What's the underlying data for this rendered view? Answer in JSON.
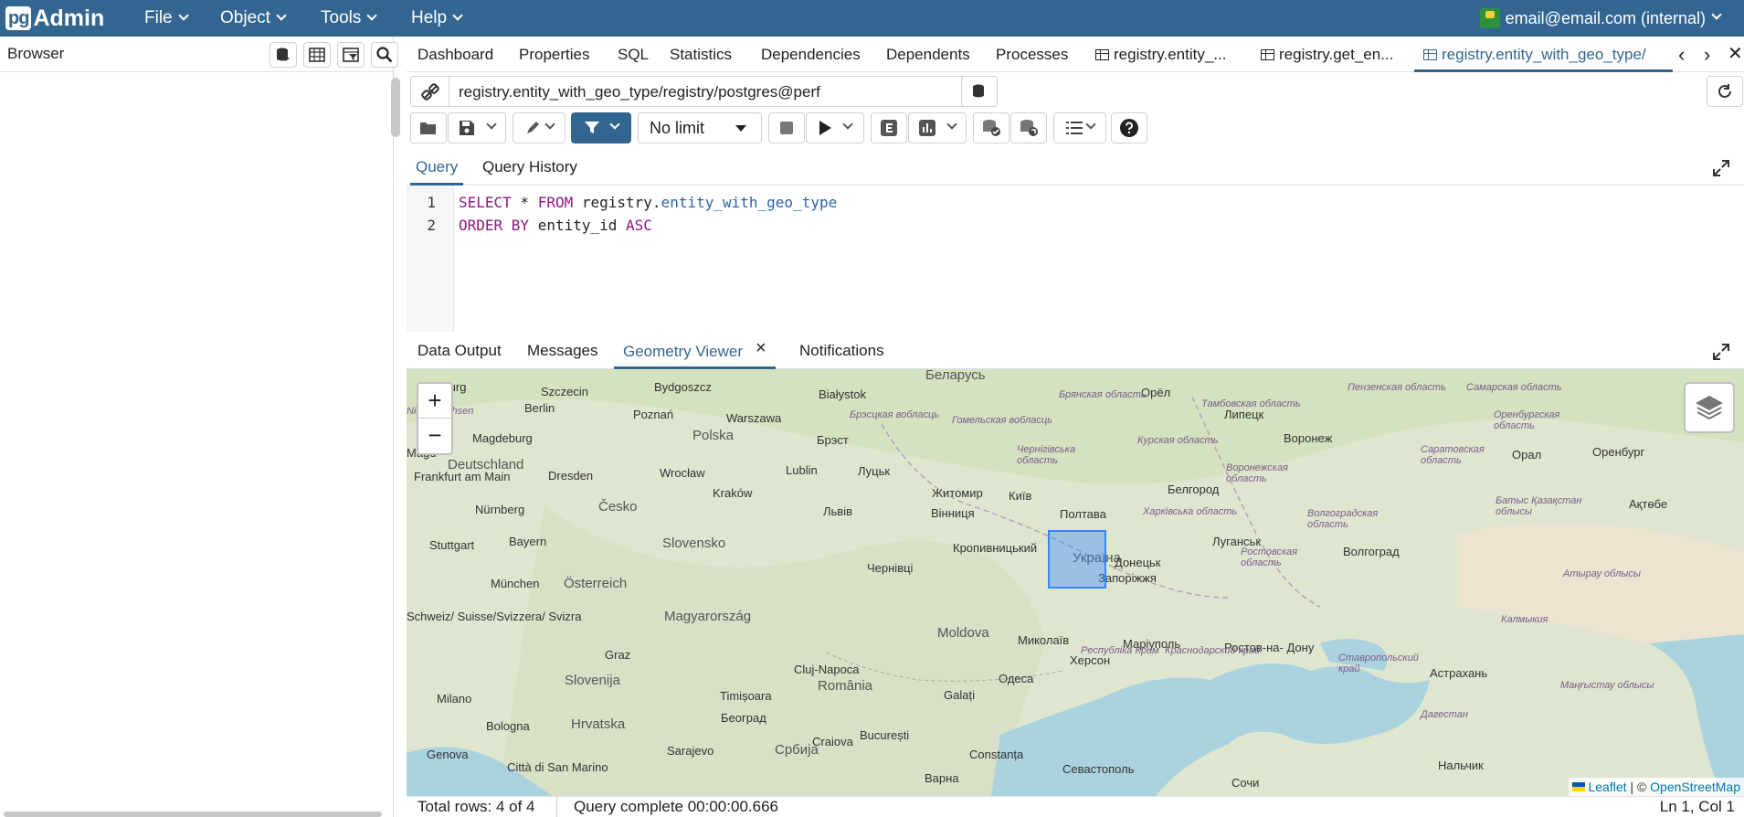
{
  "app": {
    "logo_pg": "pg",
    "logo_admin": "Admin"
  },
  "menu": {
    "file": "File",
    "object": "Object",
    "tools": "Tools",
    "help": "Help"
  },
  "user": {
    "label": "email@email.com (internal)"
  },
  "browser": {
    "title": "Browser"
  },
  "tabs": {
    "dashboard": "Dashboard",
    "properties": "Properties",
    "sql": "SQL",
    "statistics": "Statistics",
    "dependencies": "Dependencies",
    "dependents": "Dependents",
    "processes": "Processes",
    "t1": "registry.entity_...",
    "t2": "registry.get_en...",
    "t3": "registry.entity_with_geo_type/"
  },
  "query_tool": {
    "connection": "registry.entity_with_geo_type/registry/postgres@perf",
    "limit": "No limit",
    "tab_query": "Query",
    "tab_history": "Query History"
  },
  "editor": {
    "line1_no": "1",
    "line2_no": "2",
    "l1_kw1": "SELECT",
    "l1_star": " * ",
    "l1_kw2": "FROM",
    "l1_schema": " registry.",
    "l1_table": "entity_with_geo_type",
    "l2_kw1": "ORDER BY",
    "l2_col": " entity_id ",
    "l2_kw2": "ASC"
  },
  "results": {
    "data_output": "Data Output",
    "messages": "Messages",
    "geometry_viewer": "Geometry Viewer",
    "close": "×",
    "notifications": "Notifications"
  },
  "map": {
    "zoom_in": "+",
    "zoom_out": "−",
    "attribution_leaflet": "Leaflet",
    "attribution_sep": " | © ",
    "attribution_osm": "OpenStreetMap",
    "water_color": "#aad3df",
    "geom_color": "#3388ff",
    "labels": [
      {
        "text": "Hamburg"
      },
      {
        "text": "Szczecin"
      },
      {
        "text": "Bydgoszcz"
      },
      {
        "text": "Białystok"
      },
      {
        "text": "Беларусь"
      },
      {
        "text": "Орёл"
      },
      {
        "text": "Berlin"
      },
      {
        "text": "Poznań"
      },
      {
        "text": "Warszawa"
      },
      {
        "text": "Брэст"
      },
      {
        "text": "Липецк"
      },
      {
        "text": "Magdeburg"
      },
      {
        "text": "Polska"
      },
      {
        "text": "Воронеж"
      },
      {
        "text": "Deutschland"
      },
      {
        "text": "Wrocław"
      },
      {
        "text": "Lublin"
      },
      {
        "text": "Луцьк"
      },
      {
        "text": "Frankfurt am Main"
      },
      {
        "text": "Dresden"
      },
      {
        "text": "Житомир"
      },
      {
        "text": "Київ"
      },
      {
        "text": "Белгород"
      },
      {
        "text": "Kraków"
      },
      {
        "text": "Nürnberg"
      },
      {
        "text": "Česko"
      },
      {
        "text": "Львів"
      },
      {
        "text": "Вінниця"
      },
      {
        "text": "Полтава"
      },
      {
        "text": "Stuttgart"
      },
      {
        "text": "Slovensko"
      },
      {
        "text": "Кропивницький"
      },
      {
        "text": "Україна"
      },
      {
        "text": "Луганськ"
      },
      {
        "text": "Донецьк"
      },
      {
        "text": "München"
      },
      {
        "text": "Österreich"
      },
      {
        "text": "Чернівці"
      },
      {
        "text": "Запоріжжя"
      },
      {
        "text": "Волгоград"
      },
      {
        "text": "Schweiz/ Suisse/Svizzera/ Svizra"
      },
      {
        "text": "Magyarország"
      },
      {
        "text": "Moldova"
      },
      {
        "text": "Миколаїв"
      },
      {
        "text": "Маріуполь"
      },
      {
        "text": "Ростов-на- Дону"
      },
      {
        "text": "Graz"
      },
      {
        "text": "Cluj-Napoca"
      },
      {
        "text": "Херсон"
      },
      {
        "text": "Slovenija"
      },
      {
        "text": "Одеса"
      },
      {
        "text": "Milano"
      },
      {
        "text": "Timișoara"
      },
      {
        "text": "România"
      },
      {
        "text": "Galați"
      },
      {
        "text": "Астрахань"
      },
      {
        "text": "Београд"
      },
      {
        "text": "Bologna"
      },
      {
        "text": "Hrvatska"
      },
      {
        "text": "Craiova"
      },
      {
        "text": "București"
      },
      {
        "text": "Genova"
      },
      {
        "text": "Sarajevo"
      },
      {
        "text": "Србија"
      },
      {
        "text": "Constanța"
      },
      {
        "text": "Севастополь"
      },
      {
        "text": "Нальчик"
      },
      {
        "text": "Città di San Marino"
      },
      {
        "text": "Варна"
      },
      {
        "text": "Сочи"
      },
      {
        "text": "Орал"
      },
      {
        "text": "Оренбург"
      },
      {
        "text": "Ақтөбе"
      },
      {
        "text": "Magd"
      },
      {
        "text": "Bayern"
      }
    ],
    "regions": [
      {
        "text": "Брянская область"
      },
      {
        "text": "Пензенская область"
      },
      {
        "text": "Самарская область"
      },
      {
        "text": "Тамбовская область"
      },
      {
        "text": "Оренбургская область"
      },
      {
        "text": "Брэсцкая вобласць"
      },
      {
        "text": "Гомельская вобласць"
      },
      {
        "text": "Курская область"
      },
      {
        "text": "Саратовская область"
      },
      {
        "text": "Чернігівська область"
      },
      {
        "text": "Воронежская область"
      },
      {
        "text": "Харківська область"
      },
      {
        "text": "Волгоградская область"
      },
      {
        "text": "Батыс Қазақстан облысы"
      },
      {
        "text": "Ростовская область"
      },
      {
        "text": "Атырау облысы"
      },
      {
        "text": "Калмыкия"
      },
      {
        "text": "Республіка Крим"
      },
      {
        "text": "Краснодарский край"
      },
      {
        "text": "Ставропольский край"
      },
      {
        "text": "Маңғыстау облысы"
      },
      {
        "text": "Дагестан"
      },
      {
        "text": "Niedersachsen"
      }
    ]
  },
  "status": {
    "rows": "Total rows: 4 of 4",
    "time": "Query complete 00:00:00.666",
    "cursor": "Ln 1, Col 1"
  }
}
